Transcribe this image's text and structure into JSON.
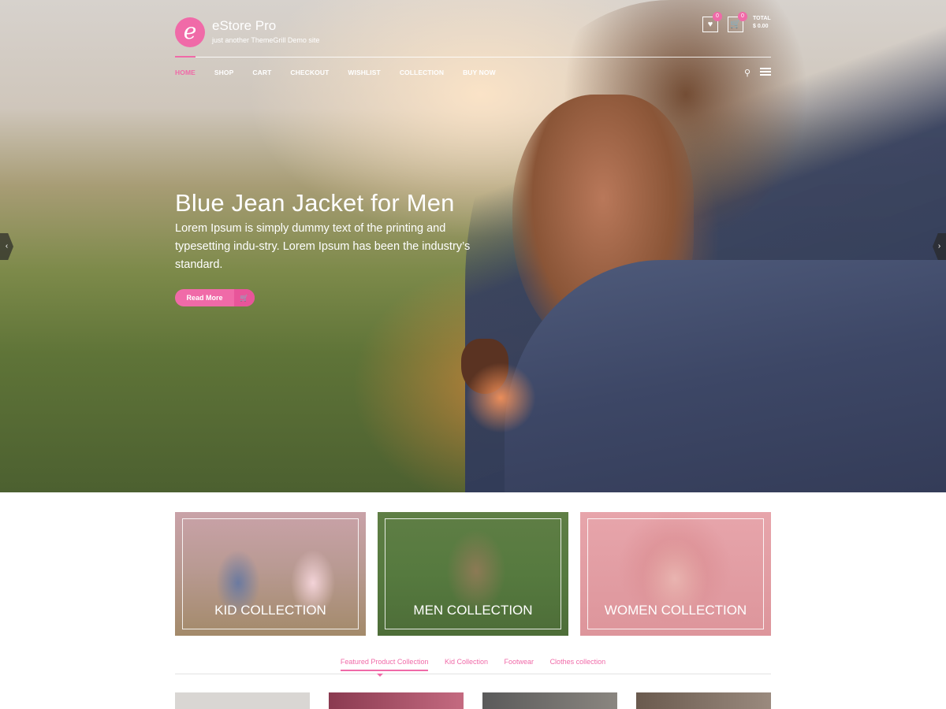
{
  "site": {
    "logo_letter": "e",
    "title": "eStore Pro",
    "description": "just another ThemeGrill Demo site"
  },
  "header": {
    "wishlist_count": "0",
    "cart_count": "0",
    "total_label": "TOTAL",
    "total_value": "$ 0.00"
  },
  "nav": {
    "items": [
      {
        "label": "HOME"
      },
      {
        "label": "SHOP"
      },
      {
        "label": "CART"
      },
      {
        "label": "CHECKOUT"
      },
      {
        "label": "WISHLIST"
      },
      {
        "label": "COLLECTION"
      },
      {
        "label": "BUY NOW"
      }
    ],
    "active": "HOME",
    "search_icon": "search-icon",
    "menu_icon": "menu-icon"
  },
  "hero": {
    "title": "Blue Jean Jacket for Men",
    "text": "Lorem Ipsum is simply dummy text of the printing and typesetting indu-stry. Lorem Ipsum has been the industry’s standard.",
    "button_label": "Read More",
    "button_icon": "cart-icon"
  },
  "slider": {
    "prev_icon": "chevron-left-icon",
    "next_icon": "chevron-right-icon"
  },
  "collections": [
    {
      "label": "KID COLLECTION"
    },
    {
      "label": "MEN COLLECTION"
    },
    {
      "label": "WOMEN COLLECTION"
    }
  ],
  "tabs": [
    {
      "label": "Featured Product Collection",
      "active": true
    },
    {
      "label": "Kid Collection",
      "active": false
    },
    {
      "label": "Footwear",
      "active": false
    },
    {
      "label": "Clothes collection",
      "active": false
    }
  ],
  "colors": {
    "accent": "#f06aa8",
    "white": "#ffffff"
  }
}
